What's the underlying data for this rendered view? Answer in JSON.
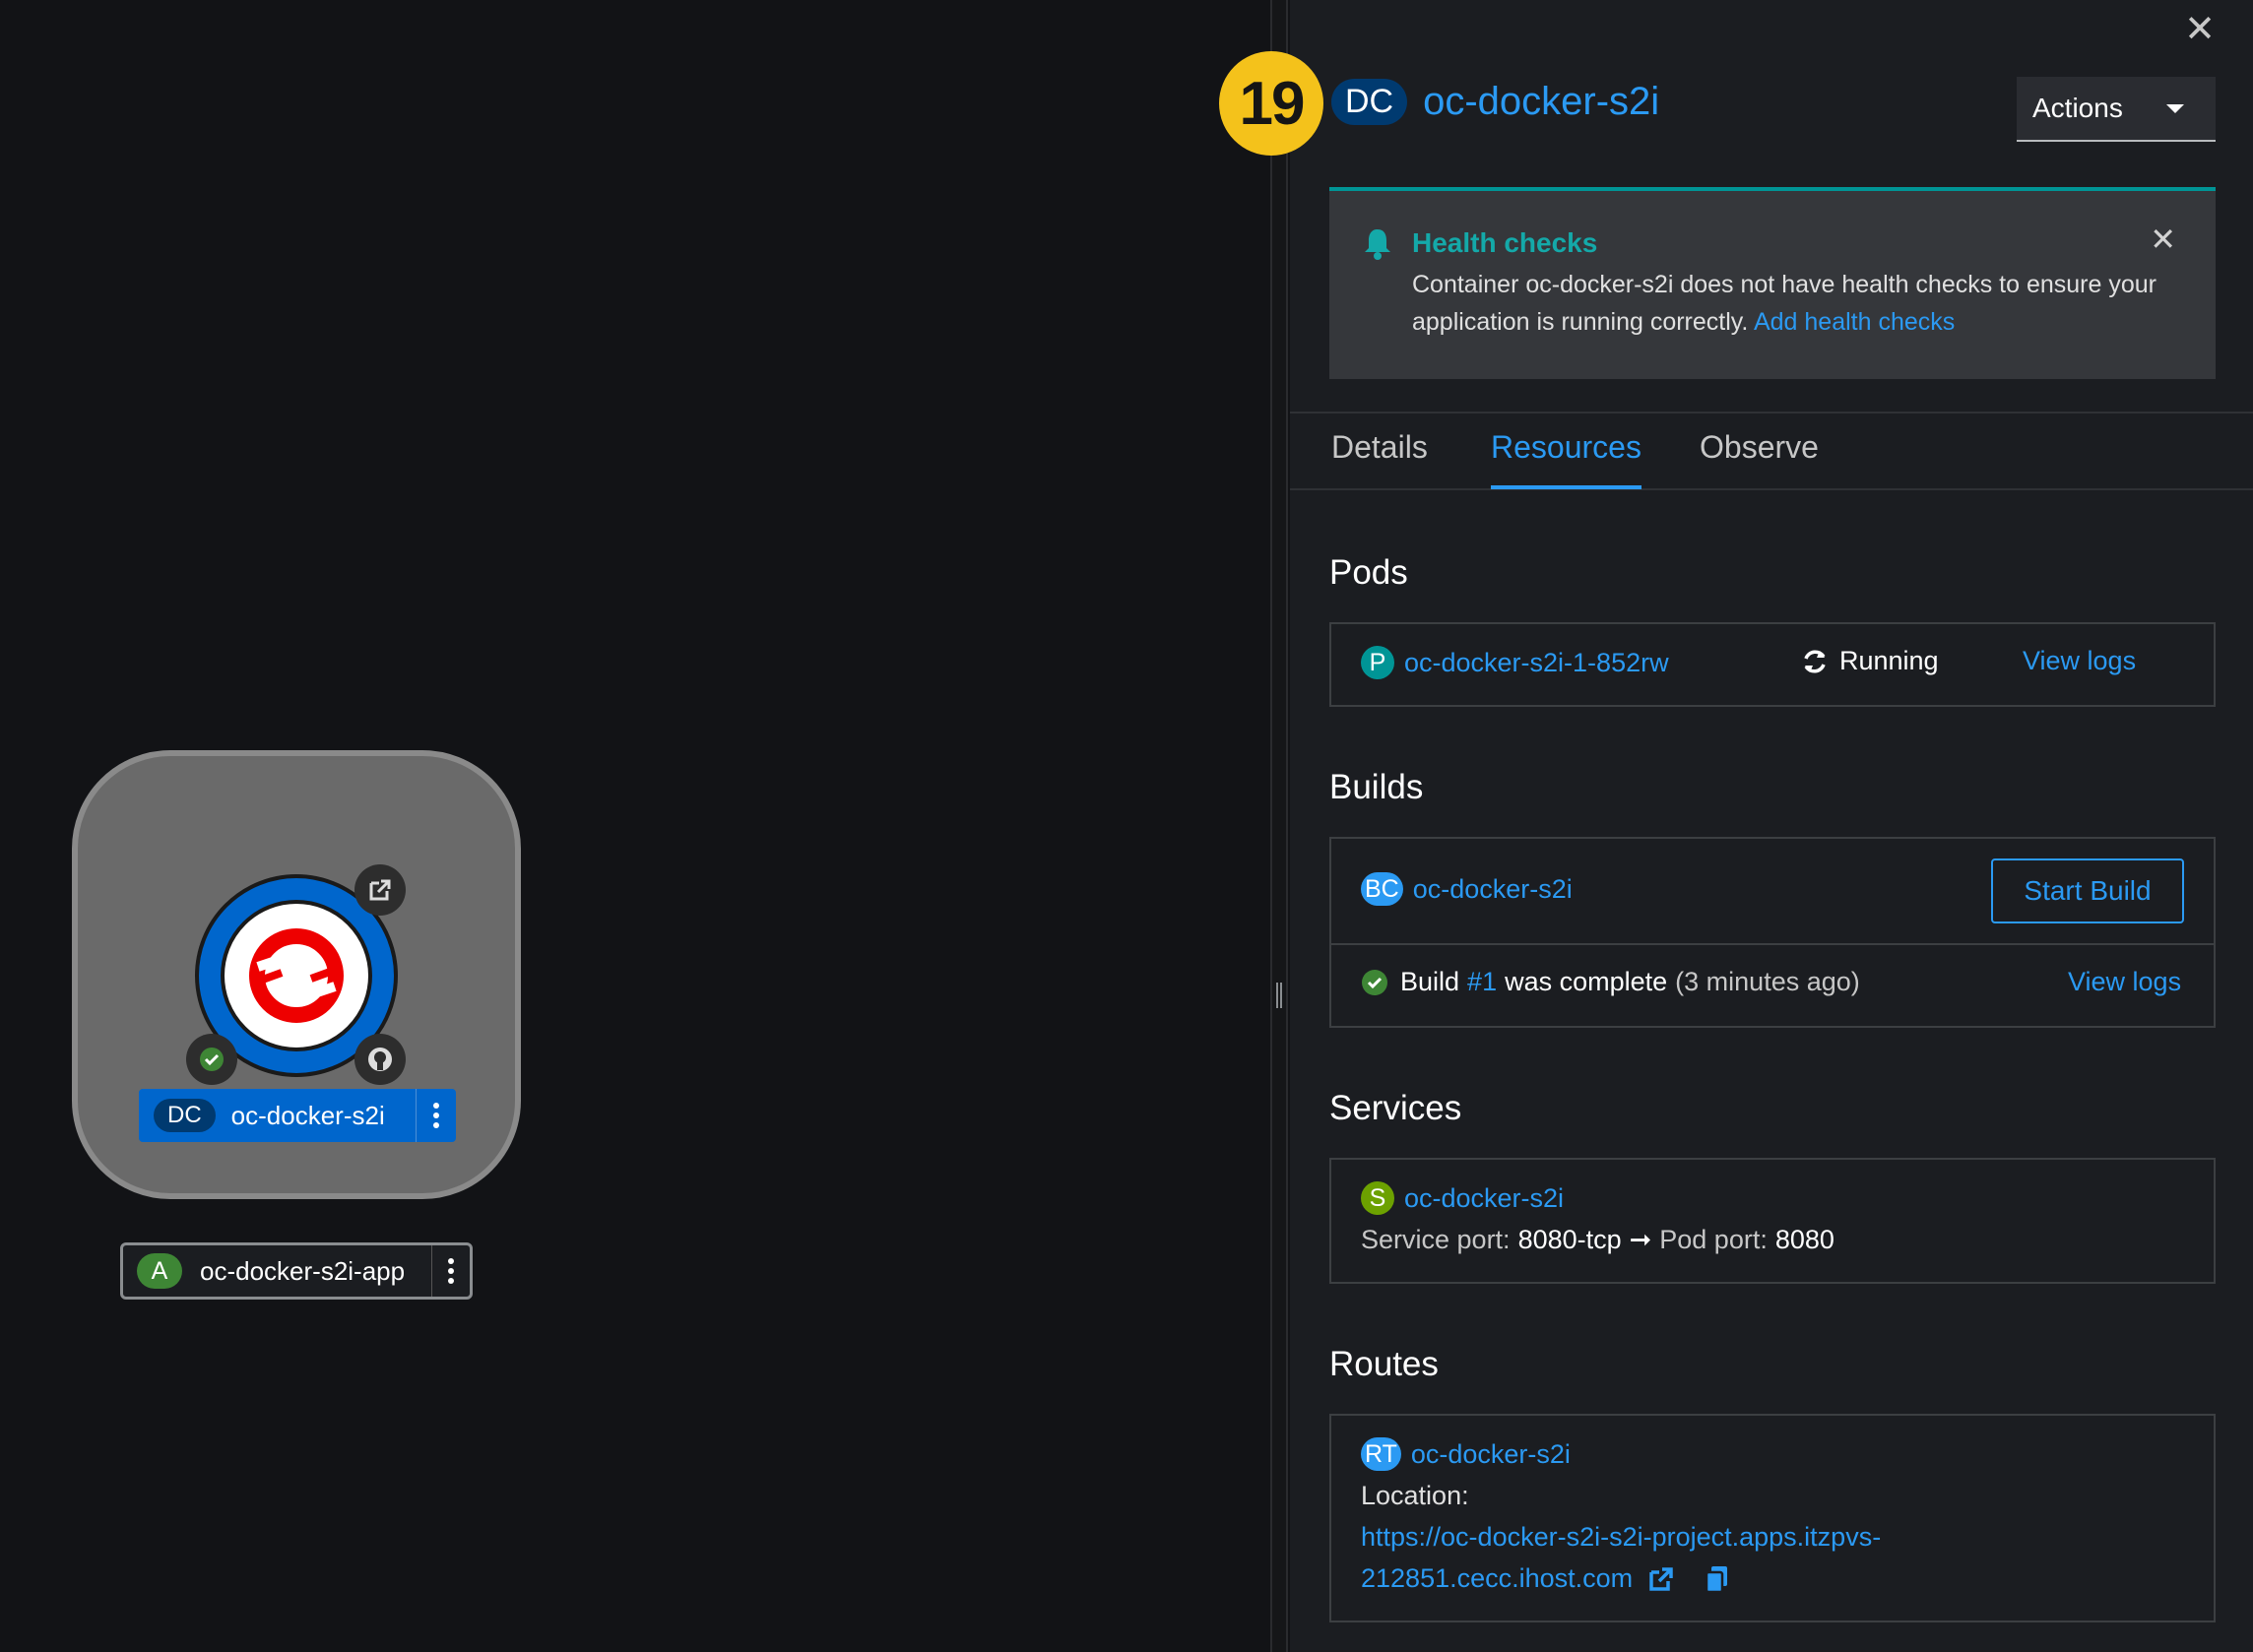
{
  "topology": {
    "node": {
      "badge": "DC",
      "name": "oc-docker-s2i"
    },
    "application": {
      "badge": "A",
      "name": "oc-docker-s2i-app"
    }
  },
  "panel": {
    "step_number": "19",
    "resource_badge": "DC",
    "resource_name": "oc-docker-s2i",
    "actions_label": "Actions",
    "alert": {
      "title": "Health checks",
      "message": "Container oc-docker-s2i does not have health checks to ensure your application is running correctly.",
      "link": "Add health checks"
    },
    "tabs": [
      "Details",
      "Resources",
      "Observe"
    ],
    "active_tab": "Resources",
    "pods": {
      "heading": "Pods",
      "badge": "P",
      "name": "oc-docker-s2i-1-852rw",
      "status": "Running",
      "logs_link": "View logs"
    },
    "builds": {
      "heading": "Builds",
      "badge": "BC",
      "name": "oc-docker-s2i",
      "start_button": "Start Build",
      "build_prefix": "Build",
      "build_number": "#1",
      "build_status": "was complete",
      "build_time": "(3 minutes ago)",
      "logs_link": "View logs"
    },
    "services": {
      "heading": "Services",
      "badge": "S",
      "name": "oc-docker-s2i",
      "service_port_label": "Service port:",
      "service_port": "8080-tcp",
      "arrow": "➞",
      "pod_port_label": "Pod port:",
      "pod_port": "8080"
    },
    "routes": {
      "heading": "Routes",
      "badge": "RT",
      "name": "oc-docker-s2i",
      "location_label": "Location:",
      "url_line1": "https://oc-docker-s2i-s2i-project.apps.itzpvs-",
      "url_line2": "212851.cecc.ihost.com"
    }
  },
  "colors": {
    "link": "#2b9af3",
    "dc_badge": "#003a70",
    "pod_badge": "#009596",
    "service_badge": "#6ca100",
    "bc_badge": "#2b9af3",
    "app_badge": "#3e8635",
    "step_badge": "#f4c21b",
    "success": "#3e8635"
  }
}
